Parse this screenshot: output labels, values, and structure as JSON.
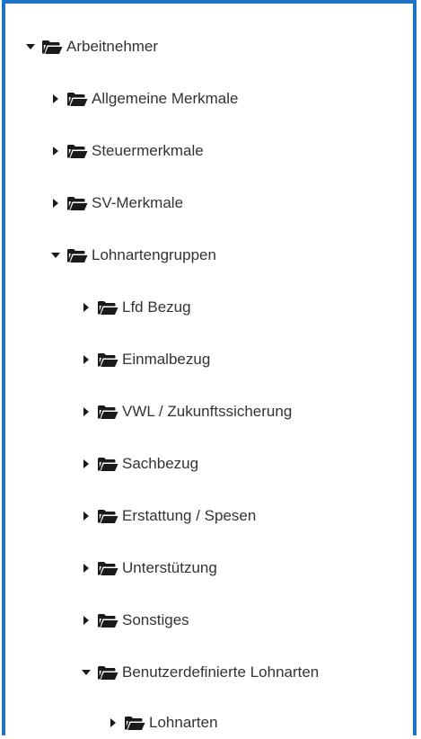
{
  "tree": {
    "items": [
      {
        "label": "Arbeitnehmer",
        "state": "expanded",
        "level": 0
      },
      {
        "label": "Allgemeine Merkmale",
        "state": "collapsed",
        "level": 1
      },
      {
        "label": "Steuermerkmale",
        "state": "collapsed",
        "level": 1
      },
      {
        "label": "SV-Merkmale",
        "state": "collapsed",
        "level": 1
      },
      {
        "label": "Lohnartengruppen",
        "state": "expanded",
        "level": 1
      },
      {
        "label": "Lfd Bezug",
        "state": "collapsed",
        "level": 2
      },
      {
        "label": "Einmalbezug",
        "state": "collapsed",
        "level": 2
      },
      {
        "label": "VWL / Zukunftssicherung",
        "state": "collapsed",
        "level": 2
      },
      {
        "label": "Sachbezug",
        "state": "collapsed",
        "level": 2
      },
      {
        "label": "Erstattung / Spesen",
        "state": "collapsed",
        "level": 2
      },
      {
        "label": "Unterstützung",
        "state": "collapsed",
        "level": 2
      },
      {
        "label": "Sonstiges",
        "state": "collapsed",
        "level": 2
      },
      {
        "label": "Benutzerdefinierte Lohnarten",
        "state": "expanded",
        "level": 2
      },
      {
        "label": "Lohnarten",
        "state": "collapsed",
        "level": 3
      }
    ]
  },
  "colors": {
    "frame_border": "#1f73c4",
    "text": "#333333",
    "icon": "#1a1a1a"
  },
  "icons": {
    "expanded": "caret-down-icon",
    "collapsed": "caret-right-icon",
    "folder": "folder-open-icon"
  }
}
